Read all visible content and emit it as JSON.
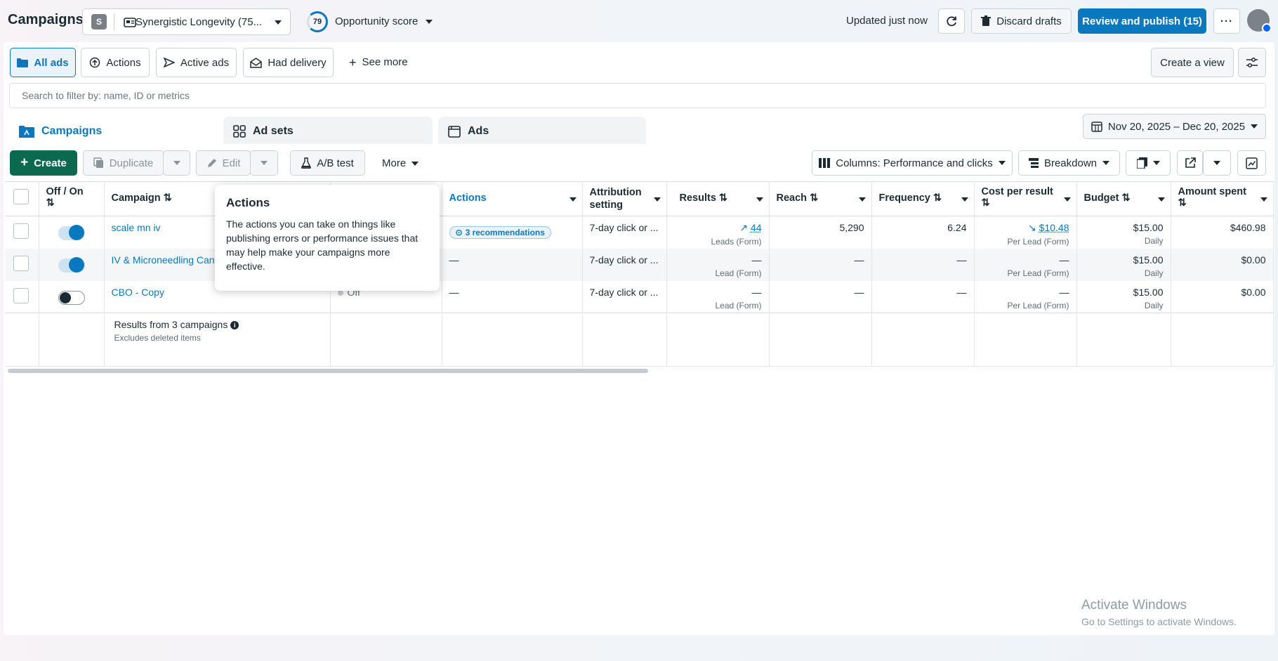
{
  "header": {
    "title": "Campaigns",
    "account_initial": "S",
    "account_name": "Synergistic Longevity (75...",
    "score_value": "79",
    "score_label": "Opportunity score",
    "updated": "Updated just now",
    "discard": "Discard drafts",
    "review": "Review and publish (15)"
  },
  "filters": {
    "all_ads": "All ads",
    "actions": "Actions",
    "active_ads": "Active ads",
    "had_delivery": "Had delivery",
    "see_more": "See more",
    "create_view": "Create a view"
  },
  "search": {
    "placeholder": "Search to filter by: name, ID or metrics"
  },
  "tabs": {
    "campaigns": "Campaigns",
    "adsets": "Ad sets",
    "ads": "Ads"
  },
  "date_range": "Nov 20, 2025 – Dec 20, 2025",
  "toolbar": {
    "create": "Create",
    "duplicate": "Duplicate",
    "edit": "Edit",
    "ab_test": "A/B test",
    "more": "More",
    "columns": "Columns: Performance and clicks",
    "breakdown": "Breakdown"
  },
  "columns": {
    "off_on": "Off / On",
    "campaign": "Campaign",
    "actions": "Actions",
    "attribution": "Attribution setting",
    "results": "Results",
    "reach": "Reach",
    "frequency": "Frequency",
    "cost": "Cost per result",
    "budget": "Budget",
    "amount": "Amount spent"
  },
  "rows": [
    {
      "name": "scale mn iv",
      "actions": "3 recommendations",
      "attribution": "7-day click or ...",
      "results": "44",
      "results_sub": "Leads (Form)",
      "reach": "5,290",
      "frequency": "6.24",
      "cost": "$10.48",
      "cost_sub": "Per Lead (Form)",
      "budget": "$15.00",
      "budget_sub": "Daily",
      "amount": "$460.98"
    },
    {
      "name": "IV & Microneedling Can",
      "actions": "—",
      "attribution": "7-day click or ...",
      "results": "—",
      "results_sub": "Lead (Form)",
      "reach": "—",
      "frequency": "—",
      "cost": "—",
      "cost_sub": "Per Lead (Form)",
      "budget": "$15.00",
      "budget_sub": "Daily",
      "amount": "$0.00"
    },
    {
      "name": "CBO - Copy",
      "delivery": "Off",
      "actions": "—",
      "attribution": "7-day click or ...",
      "results": "—",
      "results_sub": "Lead (Form)",
      "reach": "—",
      "frequency": "—",
      "cost": "—",
      "cost_sub": "Per Lead (Form)",
      "budget": "$15.00",
      "budget_sub": "Daily",
      "amount": "$0.00"
    }
  ],
  "summary": {
    "label": "Results from 3 campaigns",
    "sub": "Excludes deleted items"
  },
  "tooltip": {
    "title": "Actions",
    "body": "The actions you can take on things like publishing errors or performance issues that may help make your campaigns more effective."
  },
  "watermark": {
    "line1": "Activate Windows",
    "line2": "Go to Settings to activate Windows."
  }
}
